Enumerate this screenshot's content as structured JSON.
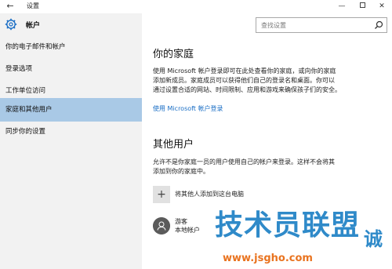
{
  "window": {
    "title": "设置",
    "back_glyph": "←",
    "min_glyph": "—",
    "close_glyph": "✕"
  },
  "sidebar": {
    "header_label": "帐户",
    "items": [
      {
        "label": "你的电子邮件和帐户",
        "active": false
      },
      {
        "label": "登录选项",
        "active": false
      },
      {
        "label": "工作单位访问",
        "active": false
      },
      {
        "label": "家庭和其他用户",
        "active": true
      },
      {
        "label": "同步你的设置",
        "active": false
      }
    ]
  },
  "search": {
    "placeholder": "查找设置"
  },
  "family": {
    "heading": "你的家庭",
    "line1": "使用 Microsoft 帐户登录即可在此处查看你的家庭，或向你的家庭",
    "line2": "添加新成员。家庭成员可以获得他们自己的登录名和桌面。你可以",
    "line3": "通过设置合适的网站、时间限制、应用和游戏来确保孩子们的安全。",
    "link": "使用 Microsoft 帐户登录"
  },
  "others": {
    "heading": "其他用户",
    "line1": "允许不是你家庭一员的用户使用自己的帐户来登录。这样不会将其",
    "line2": "添加到你的家庭中。",
    "add_label": "将其他人添加到这台电脑",
    "plus_glyph": "+",
    "guest_name": "游客",
    "guest_type": "本地帐户"
  },
  "watermark": {
    "main": "技术员联盟",
    "side": "诚",
    "url": "www.jsgho.com"
  },
  "colors": {
    "accent": "#1a6ec5",
    "active_item": "#a9c9e6",
    "sidebar_bg": "#f2f2f2",
    "watermark_blue": "#2f8ac9",
    "watermark_orange": "#e9731f"
  }
}
